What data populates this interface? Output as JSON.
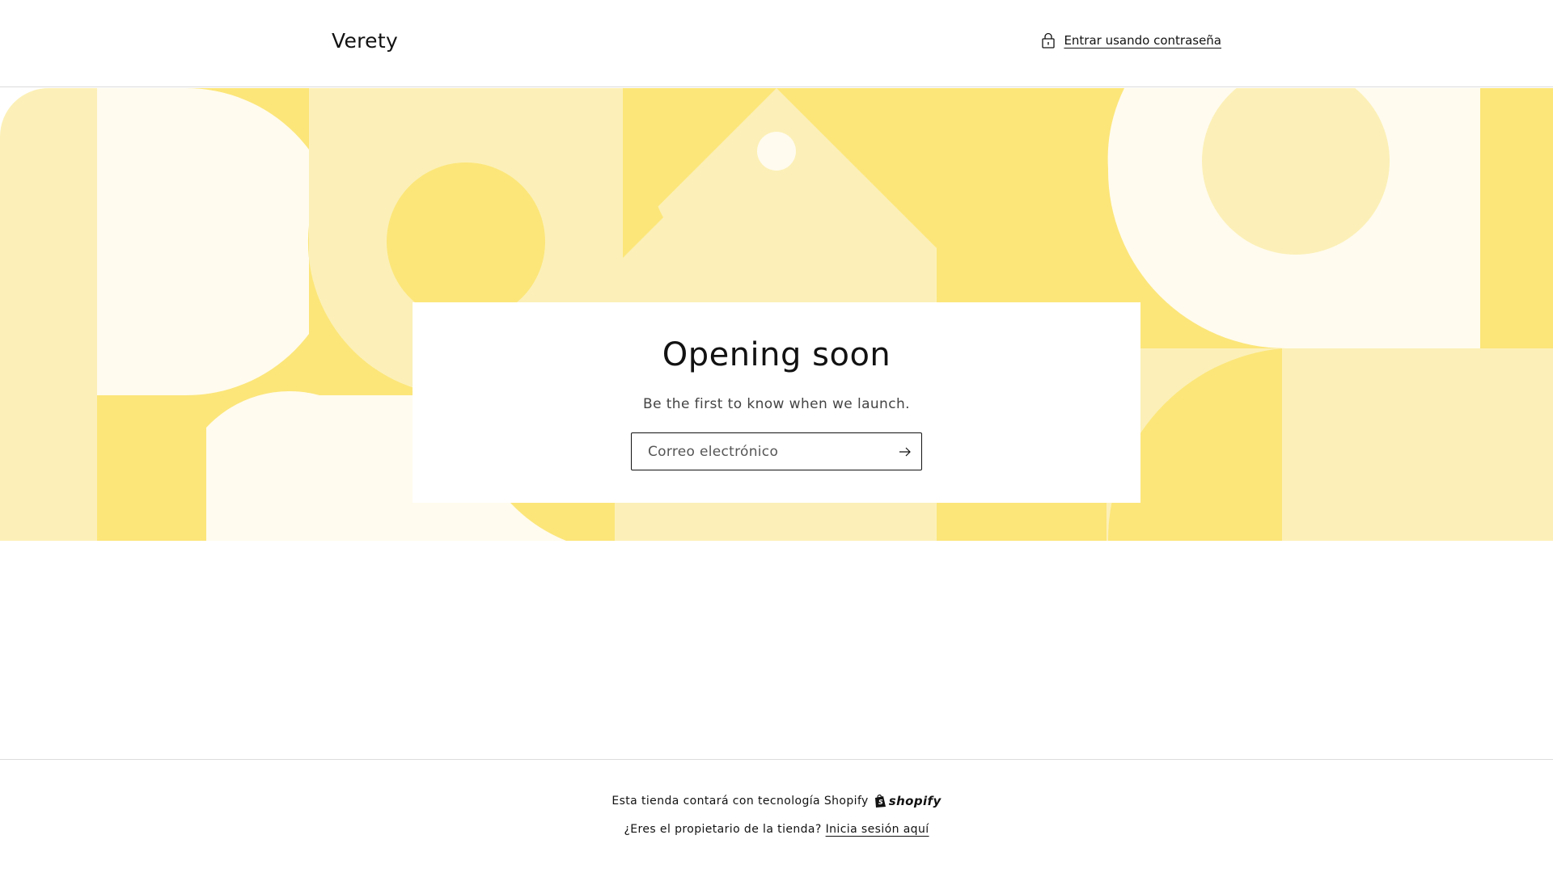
{
  "header": {
    "store_name": "Verety",
    "password_link": "Entrar usando contraseña",
    "lock_icon": "lock-icon"
  },
  "banner": {
    "colors": {
      "light": "#fcf0b8",
      "cream": "#fffbee",
      "yellow": "#fce67a"
    }
  },
  "card": {
    "title": "Opening soon",
    "subtitle": "Be the first to know when we launch.",
    "email_placeholder": "Correo electrónico",
    "submit_icon": "arrow-right-icon"
  },
  "footer": {
    "powered_by": "Esta tienda contará con tecnología Shopify",
    "shopify_logo_text": "shopify",
    "owner_question": "¿Eres el propietario de la tienda?",
    "owner_link": "Inicia sesión aquí"
  }
}
